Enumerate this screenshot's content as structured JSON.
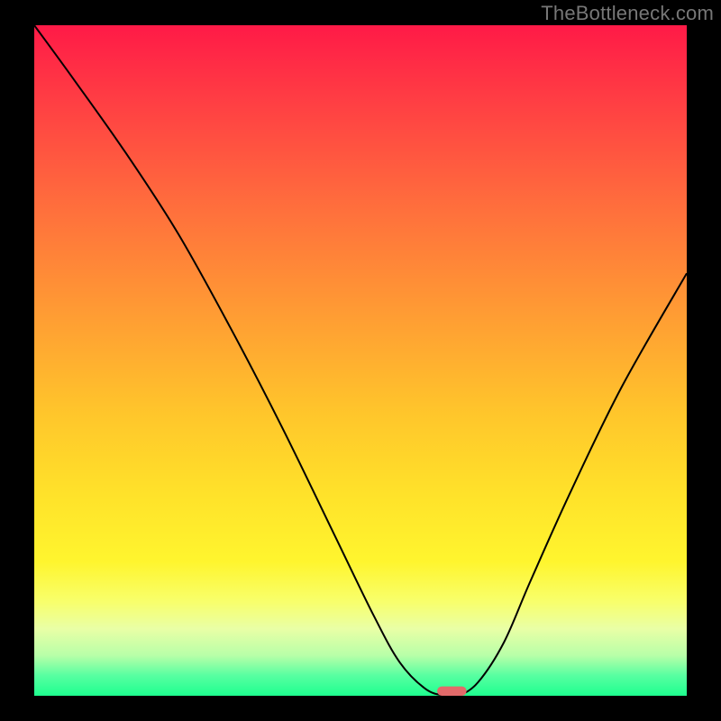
{
  "watermark": "TheBottleneck.com",
  "chart_data": {
    "type": "line",
    "title": "",
    "xlabel": "",
    "ylabel": "",
    "xlim": [
      0,
      100
    ],
    "ylim": [
      0,
      100
    ],
    "series": [
      {
        "name": "bottleneck-curve",
        "x": [
          0,
          6,
          14,
          22,
          30,
          38,
          46,
          52,
          56,
          60,
          63,
          65,
          68,
          72,
          76,
          82,
          90,
          100
        ],
        "y": [
          100,
          92,
          81,
          69,
          55,
          40,
          24,
          12,
          5,
          1,
          0,
          0,
          2,
          8,
          17,
          30,
          46,
          63
        ]
      }
    ],
    "marker": {
      "name": "optimal-point",
      "x": 64,
      "y": 0,
      "color": "#e26a6a",
      "width_pct": 4.5,
      "height_pct": 1.4
    },
    "gradient_stops": [
      {
        "pct": 0,
        "color": "#ff1a47"
      },
      {
        "pct": 10,
        "color": "#ff3a44"
      },
      {
        "pct": 26,
        "color": "#ff6b3d"
      },
      {
        "pct": 42,
        "color": "#ff9934"
      },
      {
        "pct": 58,
        "color": "#ffc62b"
      },
      {
        "pct": 70,
        "color": "#ffe22a"
      },
      {
        "pct": 80,
        "color": "#fff52e"
      },
      {
        "pct": 86,
        "color": "#f8ff6c"
      },
      {
        "pct": 90,
        "color": "#e9ffa6"
      },
      {
        "pct": 94,
        "color": "#b8ffa8"
      },
      {
        "pct": 97,
        "color": "#57ffa1"
      },
      {
        "pct": 100,
        "color": "#1eff8f"
      }
    ]
  }
}
